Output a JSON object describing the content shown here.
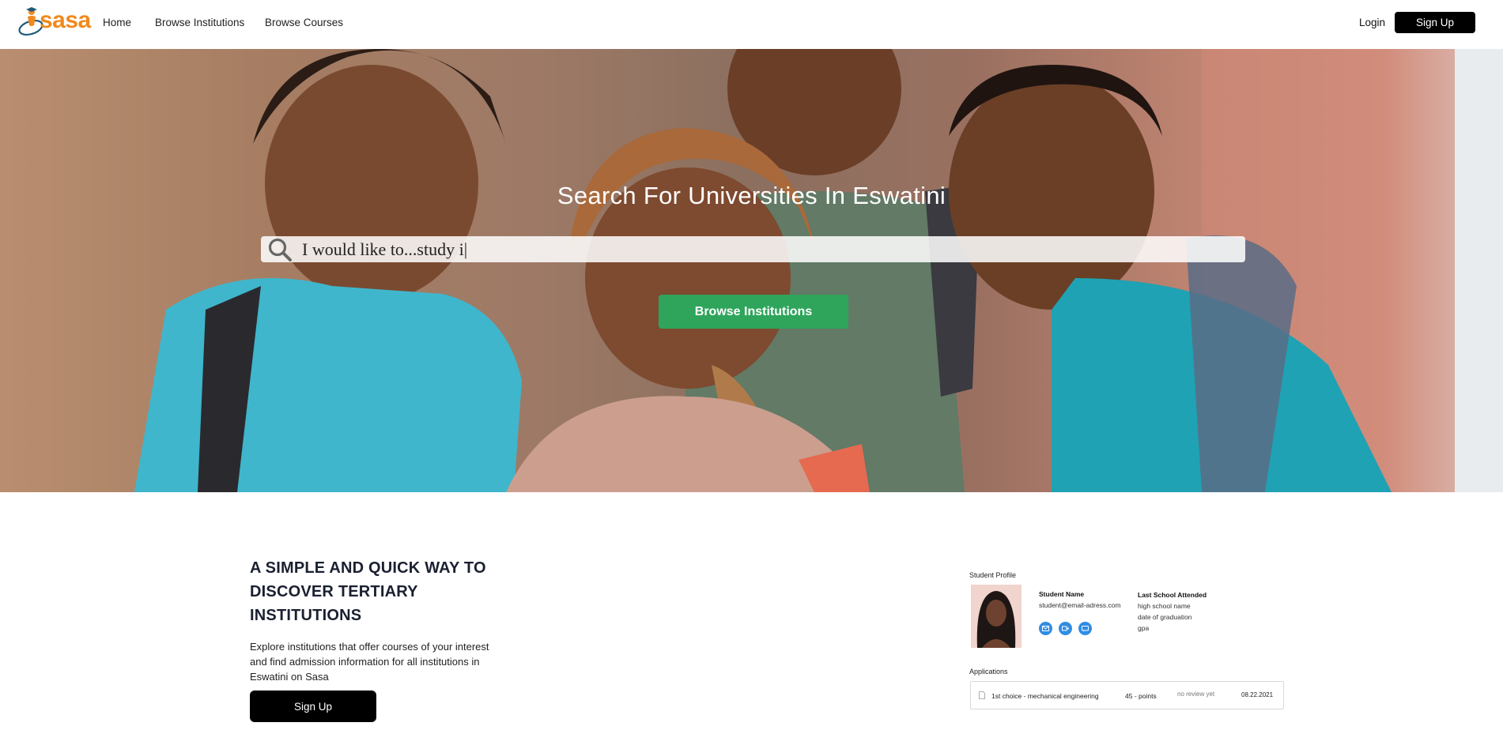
{
  "nav": {
    "logo_text": "sasa",
    "home": "Home",
    "browse_institutions": "Browse Institutions",
    "browse_courses": "Browse Courses",
    "login": "Login",
    "signup": "Sign Up"
  },
  "hero": {
    "title": "Search For Universities In Eswatini",
    "search_value": "I would like to...study i|",
    "button": "Browse Institutions"
  },
  "info": {
    "heading": "A SIMPLE AND QUICK WAY TO DISCOVER TERTIARY INSTITUTIONS",
    "text": "Explore institutions that offer courses of your interest and find admission information for all institutions in Eswatini on Sasa",
    "button": "Sign Up"
  },
  "mockup": {
    "section_title": "Student Profile",
    "student_name": "Student Name",
    "student_email": "student@email-adress.com",
    "school_heading": "Last School Attended",
    "school_name": "high school name",
    "graduation": "date of graduation",
    "gpa": "gpa",
    "applications_title": "Applications",
    "application": {
      "choice": "1st choice - mechanical engineering",
      "points": "45 - points",
      "status": "no review yet",
      "date": "08.22.2021"
    }
  },
  "colors": {
    "brand_orange": "#f08a1c",
    "hero_button_green": "#2ea55b",
    "profile_icon_blue": "#2f8de4"
  },
  "icons": [
    "sasa-logo",
    "search-icon",
    "mail-icon",
    "video-icon",
    "chat-icon",
    "document-icon"
  ]
}
